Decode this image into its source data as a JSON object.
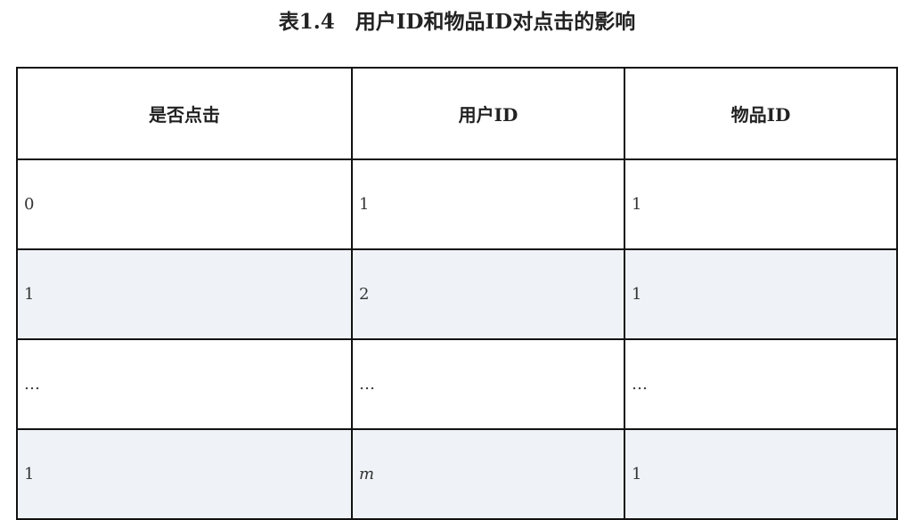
{
  "caption": "表1.4　用户ID和物品ID对点击的影响",
  "table": {
    "headers": [
      "是否点击",
      "用户ID",
      "物品ID"
    ],
    "rows": [
      [
        "0",
        "1",
        "1"
      ],
      [
        "1",
        "2",
        "1"
      ],
      [
        "…",
        "…",
        "…"
      ],
      [
        "1",
        "m",
        "1"
      ]
    ]
  }
}
